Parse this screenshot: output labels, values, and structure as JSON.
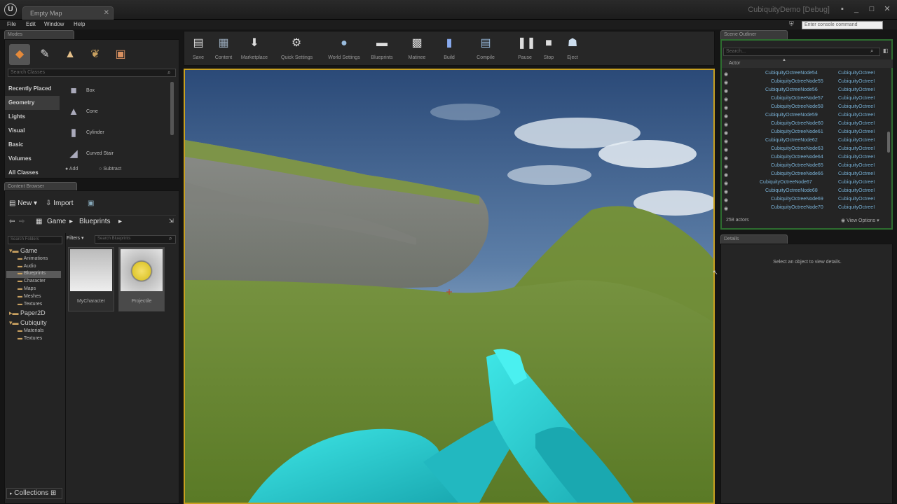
{
  "window": {
    "tab": "Empty Map",
    "project": "CubiquityDemo [Debug]"
  },
  "menus": [
    "File",
    "Edit",
    "Window",
    "Help"
  ],
  "command_placeholder": "Enter console command",
  "modes": {
    "tab": "Modes",
    "search_placeholder": "Search Classes",
    "categories": [
      "Recently Placed",
      "Geometry",
      "Lights",
      "Visual",
      "Basic",
      "Volumes",
      "All Classes"
    ],
    "items": [
      "Box",
      "Cone",
      "Cylinder",
      "Curved Stair"
    ],
    "add_label": "Add",
    "subtract_label": "Subtract"
  },
  "content_browser": {
    "tab": "Content Browser",
    "new_label": "New",
    "import_label": "Import",
    "path": [
      "Game",
      "Blueprints"
    ],
    "folder_search_placeholder": "Search Folders",
    "filters_label": "Filters",
    "asset_search_placeholder": "Search Blueprints",
    "tree": [
      {
        "label": "Game",
        "level": 0
      },
      {
        "label": "Animations",
        "level": 1
      },
      {
        "label": "Audio",
        "level": 1
      },
      {
        "label": "Blueprints",
        "level": 1
      },
      {
        "label": "Character",
        "level": 1
      },
      {
        "label": "Maps",
        "level": 1
      },
      {
        "label": "Meshes",
        "level": 1
      },
      {
        "label": "Textures",
        "level": 1
      },
      {
        "label": "Paper2D",
        "level": 0
      },
      {
        "label": "Cubiquity",
        "level": 0
      },
      {
        "label": "Materials",
        "level": 1
      },
      {
        "label": "Textures",
        "level": 1
      }
    ],
    "assets": [
      "MyCharacter",
      "Projectile"
    ],
    "collections_label": "Collections"
  },
  "toolbar": [
    "Save",
    "Content",
    "Marketplace",
    "Quick Settings",
    "World Settings",
    "Blueprints",
    "Matinee",
    "Build",
    "Compile",
    "Pause",
    "Stop",
    "Eject"
  ],
  "outliner": {
    "tab": "Scene Outliner",
    "search_placeholder": "Search...",
    "column": "Actor",
    "rows": [
      {
        "name": "CubiquityOctreeNode54",
        "type": "CubiquityOctreeI",
        "level": 1
      },
      {
        "name": "CubiquityOctreeNode55",
        "type": "CubiquityOctreeI",
        "level": 2
      },
      {
        "name": "CubiquityOctreeNode56",
        "type": "CubiquityOctreeI",
        "level": 1
      },
      {
        "name": "CubiquityOctreeNode57",
        "type": "CubiquityOctreeI",
        "level": 2
      },
      {
        "name": "CubiquityOctreeNode58",
        "type": "CubiquityOctreeI",
        "level": 2
      },
      {
        "name": "CubiquityOctreeNode59",
        "type": "CubiquityOctreeI",
        "level": 1
      },
      {
        "name": "CubiquityOctreeNode60",
        "type": "CubiquityOctreeI",
        "level": 2
      },
      {
        "name": "CubiquityOctreeNode61",
        "type": "CubiquityOctreeI",
        "level": 2
      },
      {
        "name": "CubiquityOctreeNode62",
        "type": "CubiquityOctreeI",
        "level": 1
      },
      {
        "name": "CubiquityOctreeNode63",
        "type": "CubiquityOctreeI",
        "level": 2
      },
      {
        "name": "CubiquityOctreeNode64",
        "type": "CubiquityOctreeI",
        "level": 2
      },
      {
        "name": "CubiquityOctreeNode65",
        "type": "CubiquityOctreeI",
        "level": 2
      },
      {
        "name": "CubiquityOctreeNode66",
        "type": "CubiquityOctreeI",
        "level": 2
      },
      {
        "name": "CubiquityOctreeNode67",
        "type": "CubiquityOctreeI",
        "level": 0
      },
      {
        "name": "CubiquityOctreeNode68",
        "type": "CubiquityOctreeI",
        "level": 1
      },
      {
        "name": "CubiquityOctreeNode69",
        "type": "CubiquityOctreeI",
        "level": 2
      },
      {
        "name": "CubiquityOctreeNode70",
        "type": "CubiquityOctreeI",
        "level": 2
      }
    ],
    "count": "258 actors",
    "view_options": "View Options"
  },
  "details": {
    "tab": "Details",
    "empty_message": "Select an object to view details."
  }
}
